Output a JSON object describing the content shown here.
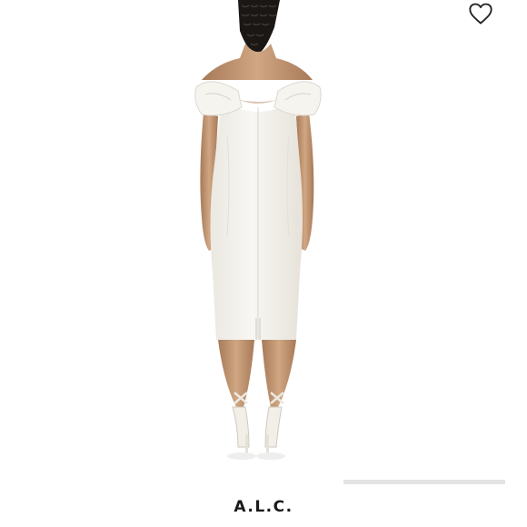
{
  "product": {
    "brand": "A.L.C.",
    "image_icon": "product-photo-back-view",
    "wishlist_icon": "heart-outline-icon"
  },
  "colors": {
    "background": "#ffffff",
    "dress": "#f5f3ee",
    "skin": "#caa07c",
    "text": "#1a1a1a",
    "carousel_track": "#e3e3e3"
  }
}
